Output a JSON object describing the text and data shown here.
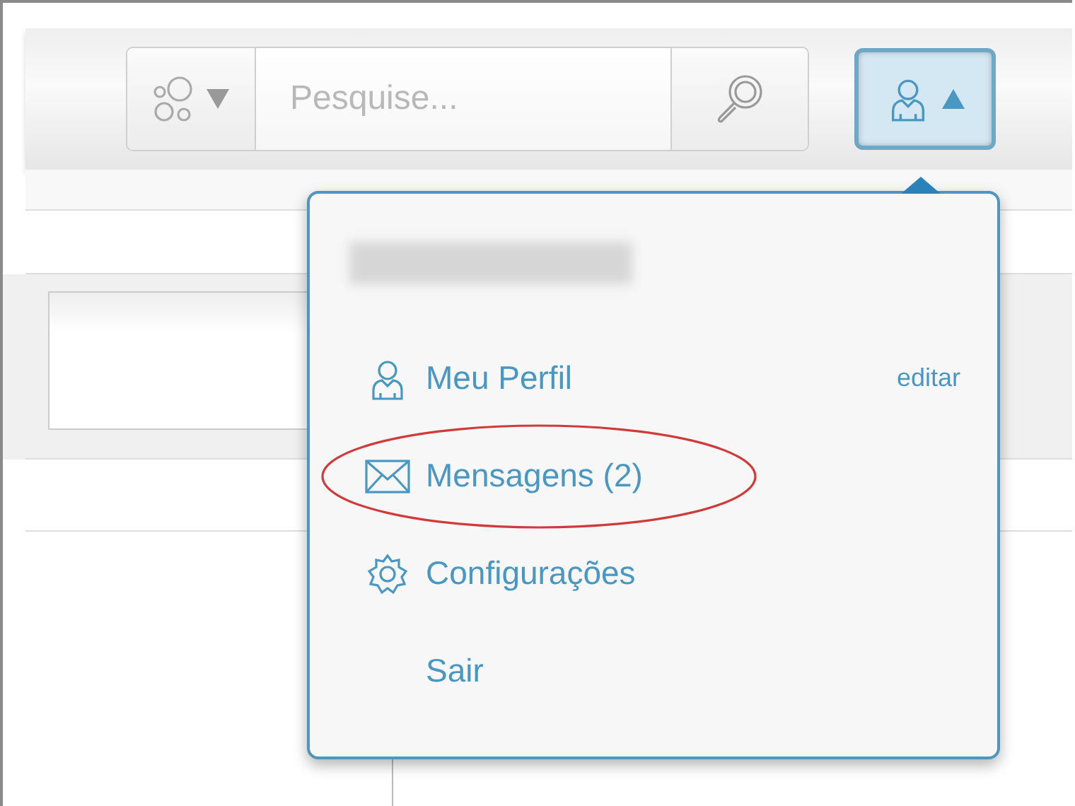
{
  "toolbar": {
    "search": {
      "placeholder": "Pesquise..."
    },
    "user_menu": {
      "expanded": true
    }
  },
  "menu": {
    "items": [
      {
        "kind": "profile",
        "label": "Meu Perfil",
        "action": "editar",
        "circled": false
      },
      {
        "kind": "messages",
        "label": "Mensagens (2)",
        "circled": true
      },
      {
        "kind": "settings",
        "label": "Configurações",
        "circled": false
      },
      {
        "kind": "plain",
        "label": "Sair",
        "circled": false
      }
    ]
  }
}
